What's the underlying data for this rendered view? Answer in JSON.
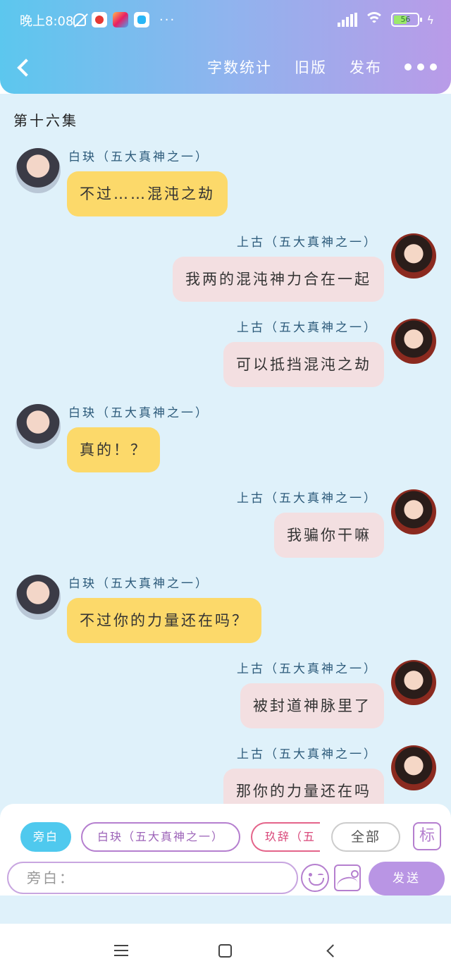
{
  "status_bar": {
    "time": "晚上8:08",
    "more": "···",
    "battery": "56",
    "battery_level": 0.56
  },
  "nav": {
    "word_count": "字数统计",
    "old_version": "旧版",
    "publish": "发布"
  },
  "episode": {
    "title": "第十六集"
  },
  "messages": [
    {
      "side": "left",
      "speaker": "白玦（五大真神之一）",
      "text": "不过……混沌之劫"
    },
    {
      "side": "right",
      "speaker": "上古（五大真神之一）",
      "text": "我两的混沌神力合在一起"
    },
    {
      "side": "right",
      "speaker": "上古（五大真神之一）",
      "text": "可以抵挡混沌之劫"
    },
    {
      "side": "left",
      "speaker": "白玦（五大真神之一）",
      "text": "真的！？"
    },
    {
      "side": "right",
      "speaker": "上古（五大真神之一）",
      "text": "我骗你干嘛"
    },
    {
      "side": "left",
      "speaker": "白玦（五大真神之一）",
      "text": "不过你的力量还在吗？"
    },
    {
      "side": "right",
      "speaker": "上古（五大真神之一）",
      "text": "被封道神脉里了"
    },
    {
      "side": "right",
      "speaker": "上古（五大真神之一）",
      "text": "那你的力量还在吗"
    }
  ],
  "characters": {
    "narrator": "旁白",
    "baijue": "白玦（五大真神之一）",
    "jiuci": "玖辞（五",
    "all": "全部",
    "tag": "标"
  },
  "composer": {
    "placeholder": "旁白：",
    "send": "发送"
  },
  "icons": {
    "back": "chevron-left-icon",
    "more": "more-dots-icon",
    "emoji": "emoji-icon",
    "image": "image-icon"
  },
  "colors": {
    "left_bubble": "#fcd96a",
    "right_bubble": "#f3dfe1",
    "accent_purple": "#b995e4",
    "accent_blue": "#4fc9ee"
  }
}
